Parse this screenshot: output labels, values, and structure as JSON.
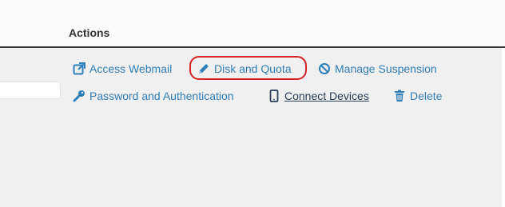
{
  "header": {
    "title": "Actions"
  },
  "actions": {
    "row1": [
      {
        "label": "Access Webmail",
        "icon": "external-link-icon"
      },
      {
        "label": "Disk and Quota",
        "icon": "pencil-icon"
      },
      {
        "label": "Manage Suspension",
        "icon": "ban-icon"
      }
    ],
    "row2": [
      {
        "label": "Password and Authentication",
        "icon": "key-icon"
      },
      {
        "label": "Connect Devices",
        "icon": "mobile-phone-icon"
      },
      {
        "label": "Delete",
        "icon": "trash-icon"
      }
    ]
  },
  "colors": {
    "link": "#2f7fb8",
    "connect_devices_text": "#2a3d58",
    "highlight": "#d42323",
    "header_border": "#3a3a3a"
  }
}
